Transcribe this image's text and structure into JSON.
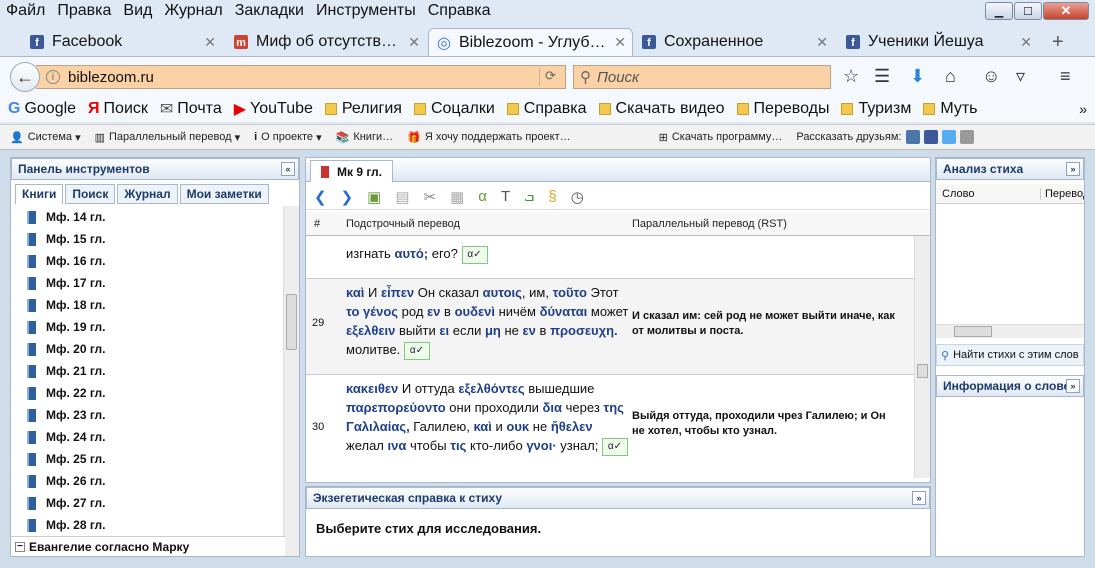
{
  "menu": [
    "Файл",
    "Правка",
    "Вид",
    "Журнал",
    "Закладки",
    "Инструменты",
    "Справка"
  ],
  "tabs": [
    {
      "label": "Facebook"
    },
    {
      "label": "Миф об отсутств…"
    },
    {
      "label": "Biblezoom - Углуб…"
    },
    {
      "label": "Сохраненное"
    },
    {
      "label": "Ученики Йешуа"
    }
  ],
  "nav": {
    "url": "biblezoom.ru",
    "search_placeholder": "Поиск"
  },
  "bookmarks": [
    "Google",
    "Поиск",
    "Почта",
    "YouTube",
    "Религия",
    "Соцалки",
    "Справка",
    "Скачать видео",
    "Переводы",
    "Туризм",
    "Муть"
  ],
  "bz_toolbar": {
    "system": "Система",
    "parallel": "Параллельный перевод",
    "about": "О проекте",
    "books": "Книги…",
    "support": "Я хочу поддержать проект…",
    "download": "Скачать программу…",
    "share": "Рассказать друзьям:"
  },
  "left": {
    "title": "Панель инструментов",
    "tabs": [
      "Книги",
      "Поиск",
      "Журнал",
      "Мои заметки"
    ],
    "chapters": [
      "Мф. 14 гл.",
      "Мф. 15 гл.",
      "Мф. 16 гл.",
      "Мф. 17 гл.",
      "Мф. 18 гл.",
      "Мф. 19 гл.",
      "Мф. 20 гл.",
      "Мф. 21 гл.",
      "Мф. 22 гл.",
      "Мф. 23 гл.",
      "Мф. 24 гл.",
      "Мф. 25 гл.",
      "Мф. 26 гл.",
      "Мф. 27 гл.",
      "Мф. 28 гл."
    ],
    "book": "Евангелие согласно Марку"
  },
  "middle": {
    "tab": "Мк 9 гл.",
    "col_num": "#",
    "col_interlinear": "Подстрочный перевод",
    "col_parallel": "Параллельный перевод (RST)",
    "prev_text_ru": "изгнать",
    "prev_text_gr": "αυτό;",
    "prev_text_ru2": "его?",
    "v29_num": "29",
    "v29_par": "И сказал им: сей род не может выйти иначе, как от молитвы и поста.",
    "v30_num": "30",
    "v30_par": "Выйдя оттуда, проходили чрез Галилею; и Он не хотел, чтобы кто узнал."
  },
  "exeg": {
    "title": "Экзегетическая справка к стиху",
    "text": "Выберите стих для исследования."
  },
  "right": {
    "title": "Анализ стиха",
    "col1": "Слово",
    "col2": "Перевод",
    "find": "Найти стихи с этим слов",
    "info": "Информация о слове"
  }
}
